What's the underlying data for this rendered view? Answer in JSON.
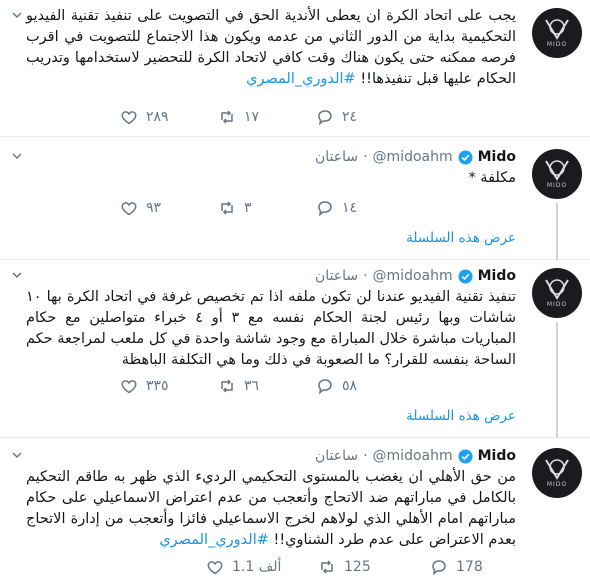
{
  "tweets": [
    {
      "body_text": "يجب على اتحاد الكرة ان يعطى الأندية الحق في التصويت على تنفيذ تقنية الفيديو التحكيمية بداية من الدور الثاني من عدمه ويكون هذا الاجتماع للتصويت في اقرب فرصه ممكنه حتى يكون هناك وقت كافي لاتحاد الكرة للتحضير لاستخدامها وتدريب الحكام عليها قبل تنفيذها!!",
      "hashtag": "#الدوري_المصري",
      "replies": "٢٤",
      "retweets": "١٧",
      "likes": "٢٨٩"
    },
    {
      "name": "Mido",
      "handle": "@midoahm",
      "time": "ساعتان",
      "body_text": "مكلفة *",
      "replies": "١٤",
      "retweets": "٣",
      "likes": "٩٣",
      "show_thread": "عرض هذه السلسلة"
    },
    {
      "name": "Mido",
      "handle": "@midoahm",
      "time": "ساعتان",
      "body_text": "تنفيذ تقنية الفيديو عندنا لن تكون ملفه اذا تم تخصيص غرفة في اتحاد الكرة بها ١٠ شاشات وبها رئيس لجنة الحكام نفسه مع ٣ أو ٤ خبراء متواصلين مع حكام المباريات مباشرة خلال المباراة مع وجود شاشة واحدة في كل ملعب لمراجعة حكم الساحة بنفسه للقرار؟ ما الصعوبة في ذلك وما هي التكلفة الباهظة",
      "replies": "٥٨",
      "retweets": "٣٦",
      "likes": "٣٣٥",
      "show_thread": "عرض هذه السلسلة"
    },
    {
      "name": "Mido",
      "handle": "@midoahm",
      "time": "ساعتان",
      "body_text": "من حق الأهلي ان يغضب بالمستوى التحكيمي الرديء الذي ظهر به طاقم التحكيم بالكامل في مباراتهم ضد الاتحاج وأتعجب من عدم اعتراض الاسماعيلي على حكام مباراتهم امام الأهلي الذي لولاهم لخرج الاسماعيلي فائزا وأتعجب من إدارة الاتحاج بعدم الاعتراض على عدم طرد الشناوي!!",
      "hashtag": "#الدوري_المصري",
      "replies": "178",
      "retweets": "125",
      "likes": "1.1 ألف"
    }
  ],
  "avatar_text": "MIDO",
  "colors": {
    "link": "#1b95e0",
    "muted": "#657786",
    "verified": "#1da1f2",
    "avatar_bg": "#1a1b1f"
  },
  "icons": [
    "reply-icon",
    "retweet-icon",
    "like-icon",
    "verified-badge-icon",
    "chevron-down-icon",
    "mido-logo-icon"
  ]
}
